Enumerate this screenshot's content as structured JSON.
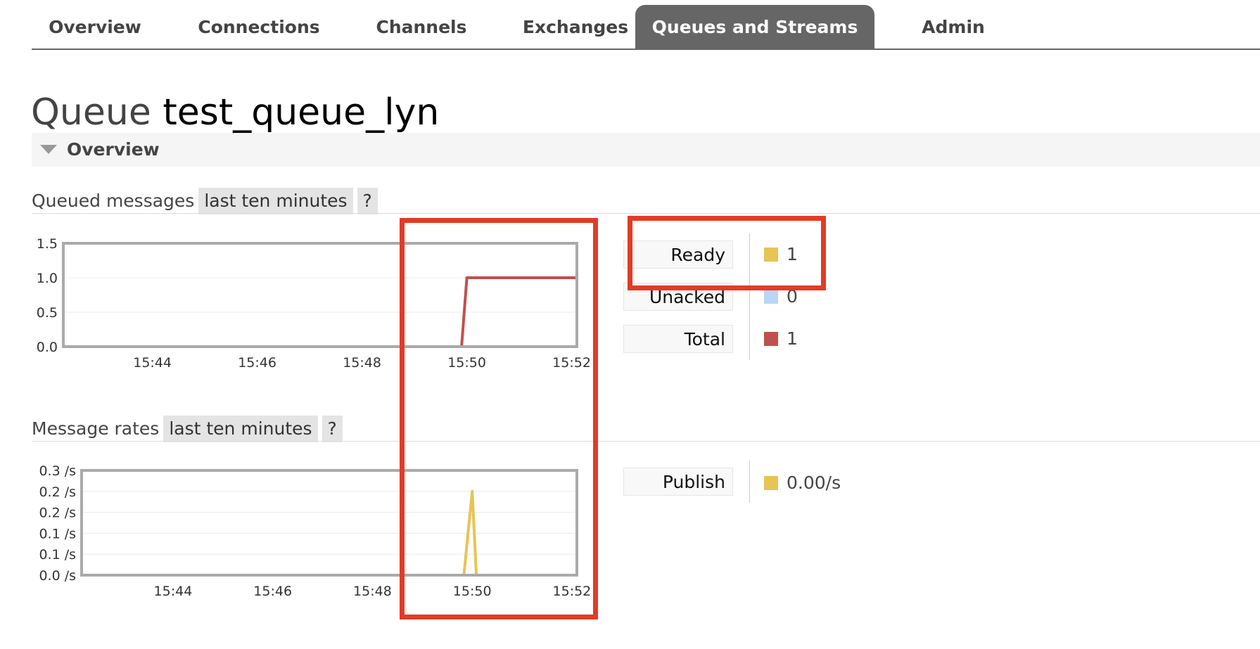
{
  "nav": {
    "tabs": [
      {
        "label": "Overview"
      },
      {
        "label": "Connections"
      },
      {
        "label": "Channels"
      },
      {
        "label": "Exchanges"
      },
      {
        "label": "Queues and Streams",
        "active": true
      },
      {
        "label": "Admin"
      }
    ]
  },
  "page": {
    "kind": "Queue",
    "name": "test_queue_lyn"
  },
  "section": {
    "label": "Overview"
  },
  "queued": {
    "label": "Queued messages",
    "range": "last ten minutes",
    "help": "?"
  },
  "rates": {
    "label": "Message rates",
    "range": "last ten minutes",
    "help": "?"
  },
  "legend_queued": [
    {
      "label": "Ready",
      "value": "1",
      "color": "#e8c356"
    },
    {
      "label": "Unacked",
      "value": "0",
      "color": "#b9d6f5"
    },
    {
      "label": "Total",
      "value": "1",
      "color": "#c0504d"
    }
  ],
  "legend_rates": [
    {
      "label": "Publish",
      "value": "0.00/s",
      "color": "#e8c356"
    }
  ],
  "chart_data": [
    {
      "type": "line",
      "x_tick_labels": [
        "15:44",
        "15:46",
        "15:48",
        "15:50",
        "15:52"
      ],
      "x_ticks": [
        "15:44",
        "15:46",
        "15:48",
        "15:50",
        "15:52"
      ],
      "xlim": [
        "15:42:18",
        "15:52:06"
      ],
      "y_tick_labels": [
        "1.5",
        "1.0",
        "0.5",
        "0.0"
      ],
      "y_ticks": [
        1.5,
        1.0,
        0.5,
        0.0
      ],
      "ylim": [
        0,
        1.5
      ],
      "grid": true,
      "series": [
        {
          "name": "Unacked",
          "color": "#b9d6f5",
          "points": [
            [
              "15:42:18",
              0
            ],
            [
              "15:52:06",
              0
            ]
          ]
        },
        {
          "name": "Total",
          "color": "#c0504d",
          "points": [
            [
              "15:42:18",
              0
            ],
            [
              "15:49:54",
              0
            ],
            [
              "15:50:00",
              1
            ],
            [
              "15:52:06",
              1
            ]
          ]
        }
      ]
    },
    {
      "type": "line",
      "x_tick_labels": [
        "15:44",
        "15:46",
        "15:48",
        "15:50",
        "15:52"
      ],
      "x_ticks": [
        "15:44",
        "15:46",
        "15:48",
        "15:50",
        "15:52"
      ],
      "xlim": [
        "15:42:10",
        "15:52:06"
      ],
      "y_tick_labels": [
        "0.3 /s",
        "0.2 /s",
        "0.2 /s",
        "0.1 /s",
        "0.1 /s",
        "0.0 /s"
      ],
      "y_ticks": [
        0.25,
        0.2,
        0.15,
        0.1,
        0.05,
        0.0
      ],
      "ylim": [
        0,
        0.25
      ],
      "grid": true,
      "series": [
        {
          "name": "Publish",
          "color": "#e8c356",
          "points": [
            [
              "15:42:10",
              0
            ],
            [
              "15:49:50",
              0
            ],
            [
              "15:50:00",
              0.2
            ],
            [
              "15:50:05",
              0
            ],
            [
              "15:52:06",
              0
            ]
          ]
        }
      ]
    }
  ]
}
